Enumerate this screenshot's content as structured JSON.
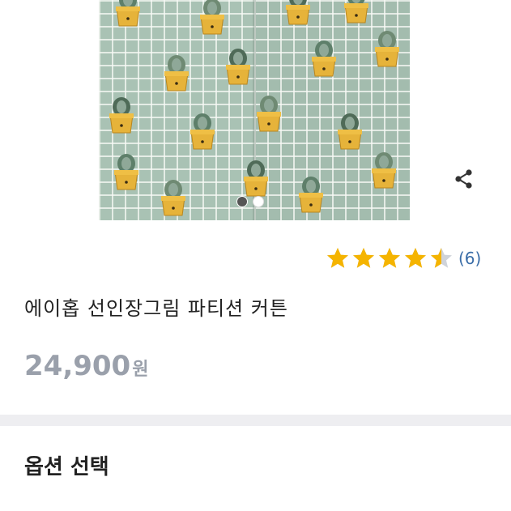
{
  "product": {
    "image_alt_icon": "cactus-pattern-curtain",
    "carousel": {
      "current": 1,
      "total": 2
    },
    "rating": {
      "value": 4.5,
      "max": 5,
      "count_label": "(6)"
    },
    "title": "에이홉 선인장그림 파티션 커튼",
    "price": {
      "amount": "24,900",
      "unit": "원"
    }
  },
  "options": {
    "heading": "옵션 선택",
    "first_item_label": ""
  },
  "colors": {
    "star": "#f5b400",
    "rating_count": "#3b6ea8",
    "price": "#9aa0ab",
    "divider": "#eeeef1"
  }
}
